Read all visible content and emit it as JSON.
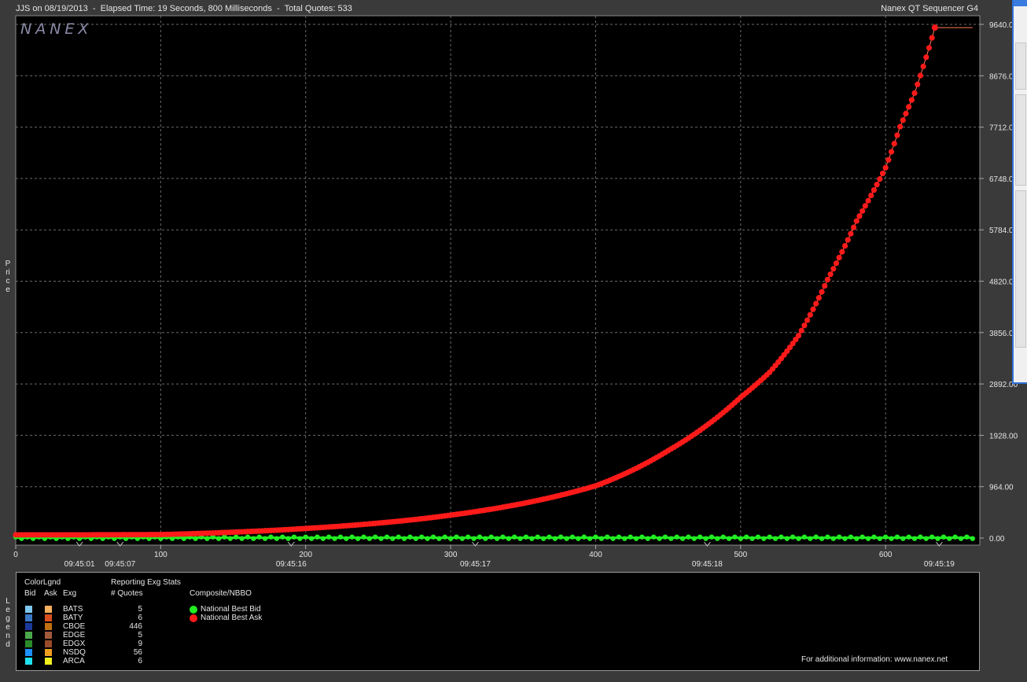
{
  "header": {
    "left_text": "JJS on 08/19/2013  -  Elapsed Time: 19 Seconds, 800 Milliseconds  -  Total Quotes: 533",
    "right_text": "Nanex QT Sequencer G4"
  },
  "watermark": "NANEX",
  "side_labels": {
    "price": "Price",
    "legend": "Legend"
  },
  "chart_data": {
    "type": "scatter",
    "x_ticks": [
      "0",
      "100",
      "200",
      "300",
      "400",
      "500",
      "600"
    ],
    "x_tick_values": [
      0,
      100,
      200,
      300,
      400,
      500,
      600
    ],
    "time_ticks": [
      {
        "label": "09:45:01",
        "x": 44
      },
      {
        "label": "09:45:07",
        "x": 72
      },
      {
        "label": "09:45:16",
        "x": 190
      },
      {
        "label": "09:45:17",
        "x": 317
      },
      {
        "label": "09:45:18",
        "x": 477
      },
      {
        "label": "09:45:19",
        "x": 637
      }
    ],
    "y_ticks": [
      "9640.00",
      "8676.00",
      "7712.00",
      "6748.00",
      "5784.00",
      "4820.00",
      "3856.00",
      "2892.00",
      "1928.00",
      "964.00",
      "0.00"
    ],
    "y_tick_values": [
      9640,
      8676,
      7712,
      6748,
      5784,
      4820,
      3856,
      2892,
      1928,
      964,
      0
    ],
    "xlim": [
      0,
      665
    ],
    "ylim": [
      0,
      9640
    ],
    "grid": true,
    "series": [
      {
        "name": "National Best Bid",
        "color": "#22ee22",
        "description": "flat near 0 across all quotes",
        "x_start": 0,
        "x_end": 660,
        "y": 5
      },
      {
        "name": "National Best Ask",
        "color": "#ff1a1a",
        "points": [
          [
            0,
            60
          ],
          [
            50,
            60
          ],
          [
            100,
            65
          ],
          [
            150,
            110
          ],
          [
            200,
            180
          ],
          [
            250,
            280
          ],
          [
            300,
            430
          ],
          [
            350,
            650
          ],
          [
            400,
            980
          ],
          [
            450,
            1640
          ],
          [
            500,
            2640
          ],
          [
            520,
            3110
          ],
          [
            540,
            3800
          ],
          [
            560,
            4850
          ],
          [
            580,
            5950
          ],
          [
            600,
            6950
          ],
          [
            610,
            7720
          ],
          [
            620,
            8350
          ],
          [
            630,
            9200
          ],
          [
            634,
            9580
          ],
          [
            660,
            9580
          ]
        ]
      }
    ]
  },
  "legend": {
    "color_legend_title": "ColorLgnd",
    "col_bid": "Bid",
    "col_ask": "Ask",
    "col_exg": "Exg",
    "stats_title": "Reporting Exg Stats",
    "stats_col": "# Quotes",
    "composite_title": "Composite/NBBO",
    "exchanges": [
      {
        "name": "BATS",
        "quotes": "5",
        "bid_color": "#7ec8f0",
        "ask_color": "#f5b060"
      },
      {
        "name": "BATY",
        "quotes": "6",
        "bid_color": "#3a78c8",
        "ask_color": "#d85020"
      },
      {
        "name": "CBOE",
        "quotes": "446",
        "bid_color": "#1a3a9a",
        "ask_color": "#c07010"
      },
      {
        "name": "EDGE",
        "quotes": "5",
        "bid_color": "#4aa84a",
        "ask_color": "#a05a3a"
      },
      {
        "name": "EDGX",
        "quotes": "9",
        "bid_color": "#2a8a2a",
        "ask_color": "#9a4a2a"
      },
      {
        "name": "NSDQ",
        "quotes": "56",
        "bid_color": "#1e90ff",
        "ask_color": "#f0a020"
      },
      {
        "name": "ARCA",
        "quotes": "6",
        "bid_color": "#20e0f0",
        "ask_color": "#f0f020"
      }
    ],
    "nbbo": [
      {
        "name": "National Best Bid",
        "color": "#22ee22"
      },
      {
        "name": "National Best Ask",
        "color": "#ff1a1a"
      }
    ],
    "footer": "For additional information: www.nanex.net"
  }
}
